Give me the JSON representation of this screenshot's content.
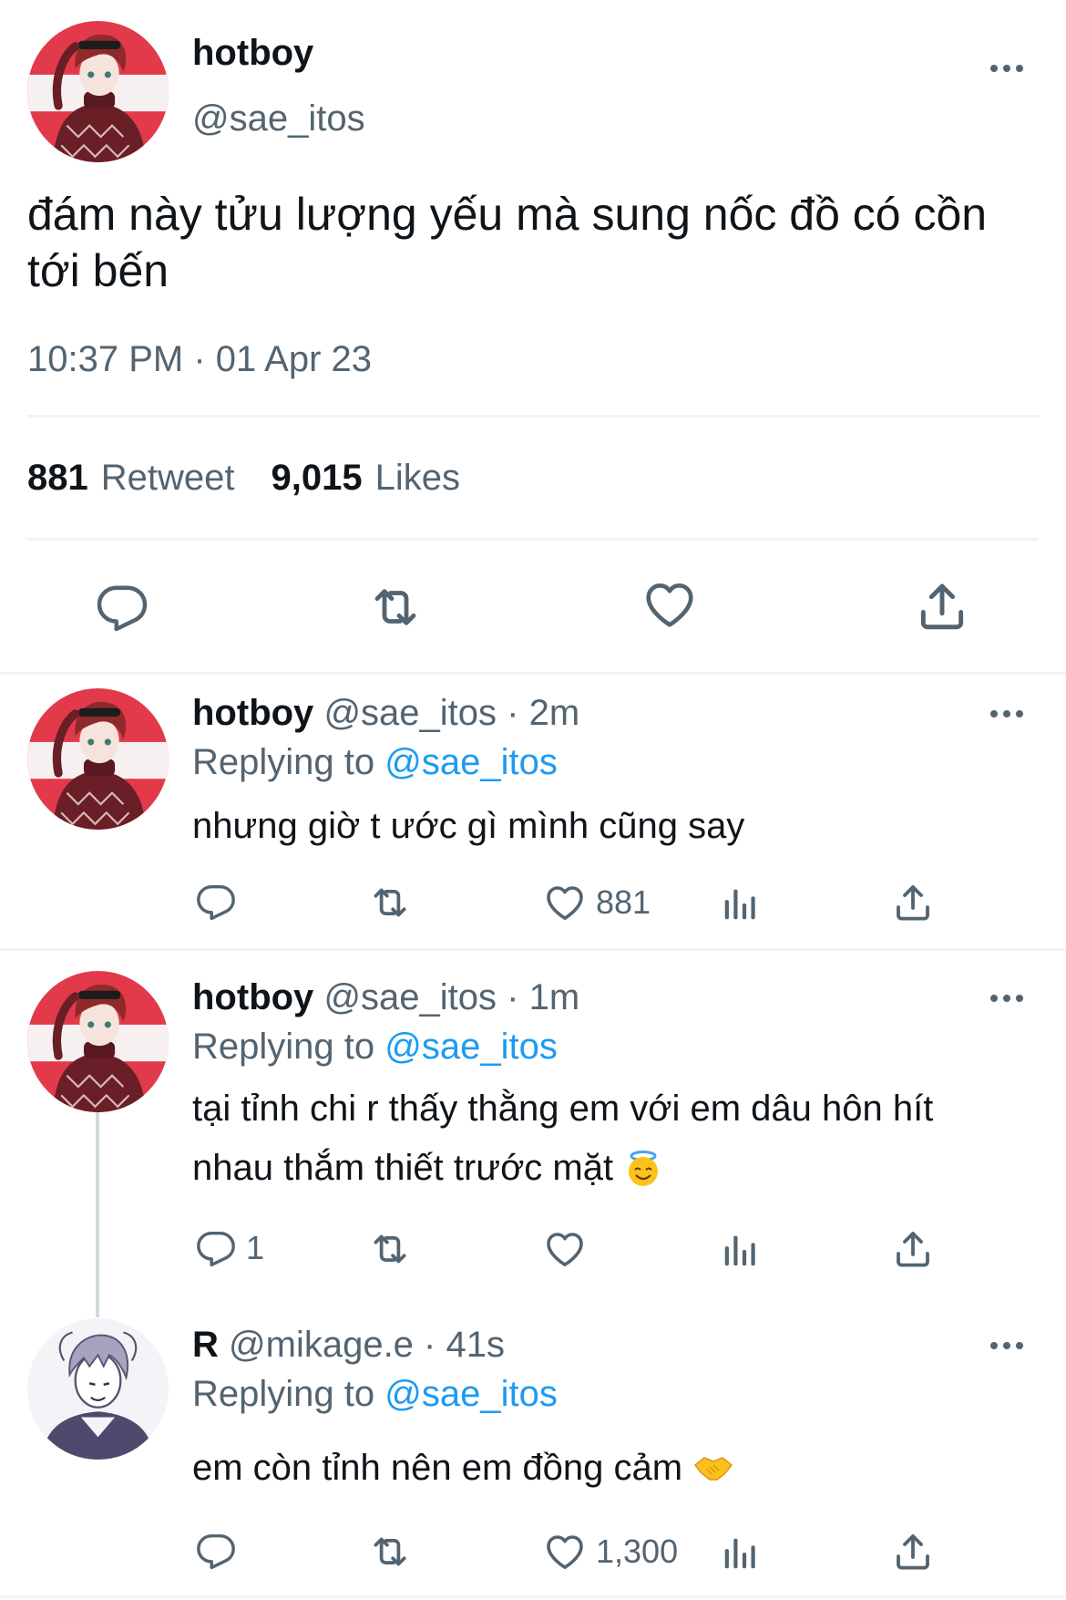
{
  "main_tweet": {
    "display_name": "hotboy",
    "handle": "@sae_itos",
    "text": "đám này tửu lượng yếu mà sung nốc đồ có cồn tới bến",
    "timestamp": "10:37 PM · 01 Apr 23",
    "stats": {
      "retweet_count": "881",
      "retweet_label": "Retweet",
      "likes_count": "9,015",
      "likes_label": "Likes"
    }
  },
  "replies": [
    {
      "display_name": "hotboy",
      "meta": "@sae_itos · 2m",
      "replying_label": "Replying to",
      "replying_handle": "@sae_itos",
      "text": "nhưng giờ t ước gì mình cũng say",
      "like_count": "881"
    },
    {
      "display_name": "hotboy",
      "meta": "@sae_itos · 1m",
      "replying_label": "Replying to",
      "replying_handle": "@sae_itos",
      "text_line1": "tại tỉnh chi r thấy thằng em với em dâu hôn hít",
      "text_line2": "nhau thắm thiết trước mặt",
      "reply_count": "1"
    },
    {
      "display_name": "R",
      "meta": "@mikage.e · 41s",
      "replying_label": "Replying to",
      "replying_handle": "@sae_itos",
      "text": "em còn tỉnh nên em đồng cảm",
      "like_count": "1,300"
    }
  ],
  "icons": {
    "reply": "reply-icon",
    "retweet": "retweet-icon",
    "like": "heart-icon",
    "views": "views-icon",
    "share": "share-icon",
    "more": "more-icon",
    "emoji_halo": "smiling-face-with-halo-emoji",
    "emoji_handshake": "handshake-emoji"
  },
  "colors": {
    "text": "#0f1419",
    "secondary": "#536471",
    "link": "#1d9bf0",
    "divider": "#eff3f4",
    "avatar_bg": "#e23a4a"
  }
}
